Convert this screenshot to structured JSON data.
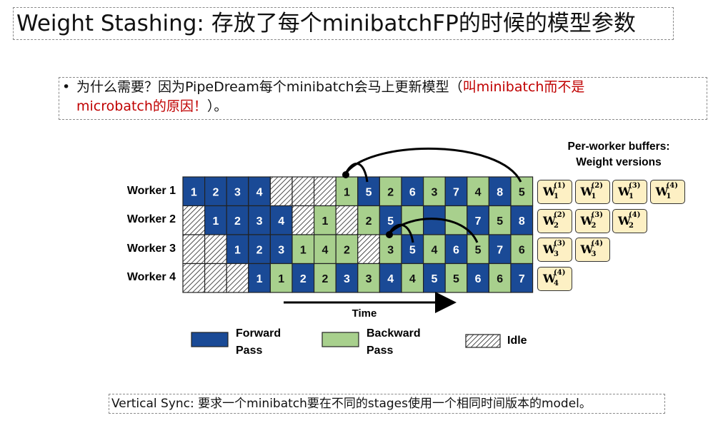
{
  "title": "Weight Stashing: 存放了每个minibatchFP的时候的模型参数",
  "bullet": {
    "marker": "•",
    "line1_black": "为什么需要？因为PipeDream每个minibatch会马上更新模型（",
    "line1_red": "叫minibatch而不是",
    "line2_red": "microbatch的原因！",
    "line2_black": "）。"
  },
  "diagram": {
    "workers": [
      "Worker 1",
      "Worker 2",
      "Worker 3",
      "Worker 4"
    ],
    "rows": [
      [
        [
          "F",
          "1"
        ],
        [
          "F",
          "2"
        ],
        [
          "F",
          "3"
        ],
        [
          "F",
          "4"
        ],
        [
          "I",
          ""
        ],
        [
          "I",
          ""
        ],
        [
          "I",
          ""
        ],
        [
          "B",
          "1"
        ],
        [
          "F",
          "5"
        ],
        [
          "B",
          "2"
        ],
        [
          "F",
          "6"
        ],
        [
          "B",
          "3"
        ],
        [
          "F",
          "7"
        ],
        [
          "B",
          "4"
        ],
        [
          "F",
          "8"
        ],
        [
          "B",
          "5"
        ]
      ],
      [
        [
          "I",
          ""
        ],
        [
          "F",
          "1"
        ],
        [
          "F",
          "2"
        ],
        [
          "F",
          "3"
        ],
        [
          "F",
          "4"
        ],
        [
          "I",
          ""
        ],
        [
          "B",
          "1"
        ],
        [
          "I",
          ""
        ],
        [
          "B",
          "2"
        ],
        [
          "F",
          "5"
        ],
        [
          "B",
          ""
        ],
        [
          "F",
          ""
        ],
        [
          "B",
          ""
        ],
        [
          "F",
          "7"
        ],
        [
          "B",
          "5"
        ],
        [
          "F",
          "8"
        ]
      ],
      [
        [
          "I",
          ""
        ],
        [
          "I",
          ""
        ],
        [
          "F",
          "1"
        ],
        [
          "F",
          "2"
        ],
        [
          "F",
          "3"
        ],
        [
          "B",
          "1"
        ],
        [
          "B",
          "4"
        ],
        [
          "B",
          "2"
        ],
        [
          "I",
          ""
        ],
        [
          "B",
          "3"
        ],
        [
          "F",
          "5"
        ],
        [
          "B",
          "4"
        ],
        [
          "F",
          "6"
        ],
        [
          "B",
          "5"
        ],
        [
          "F",
          "7"
        ],
        [
          "B",
          "6"
        ]
      ],
      [
        [
          "I",
          ""
        ],
        [
          "I",
          ""
        ],
        [
          "I",
          ""
        ],
        [
          "F",
          "1"
        ],
        [
          "B",
          "1"
        ],
        [
          "F",
          "2"
        ],
        [
          "B",
          "2"
        ],
        [
          "F",
          "3"
        ],
        [
          "B",
          "3"
        ],
        [
          "F",
          "4"
        ],
        [
          "B",
          "4"
        ],
        [
          "F",
          "5"
        ],
        [
          "B",
          "5"
        ],
        [
          "F",
          "6"
        ],
        [
          "B",
          "6"
        ],
        [
          "F",
          "7"
        ]
      ]
    ],
    "buffers_header_line1": "Per-worker buffers:",
    "buffers_header_line2": "Weight versions",
    "buffers": [
      [
        {
          "sub": "1",
          "sup": "(1)"
        },
        {
          "sub": "1",
          "sup": "(2)"
        },
        {
          "sub": "1",
          "sup": "(3)"
        },
        {
          "sub": "1",
          "sup": "(4)"
        }
      ],
      [
        {
          "sub": "2",
          "sup": "(2)"
        },
        {
          "sub": "2",
          "sup": "(3)"
        },
        {
          "sub": "2",
          "sup": "(4)"
        }
      ],
      [
        {
          "sub": "3",
          "sup": "(3)"
        },
        {
          "sub": "3",
          "sup": "(4)"
        }
      ],
      [
        {
          "sub": "4",
          "sup": "(4)"
        }
      ]
    ],
    "weight_symbol": "W",
    "time_label": "Time",
    "legend": {
      "forward_line1": "Forward",
      "forward_line2": "Pass",
      "backward_line1": "Backward",
      "backward_line2": "Pass",
      "idle": "Idle"
    },
    "colors": {
      "forward": "#1a4a96",
      "backward": "#a8d08d",
      "idle": "#ffffff",
      "buffer": "#fdf0c4"
    }
  },
  "footer": "Vertical Sync: 要求一个minibatch要在不同的stages使用一个相同时间版本的model。"
}
